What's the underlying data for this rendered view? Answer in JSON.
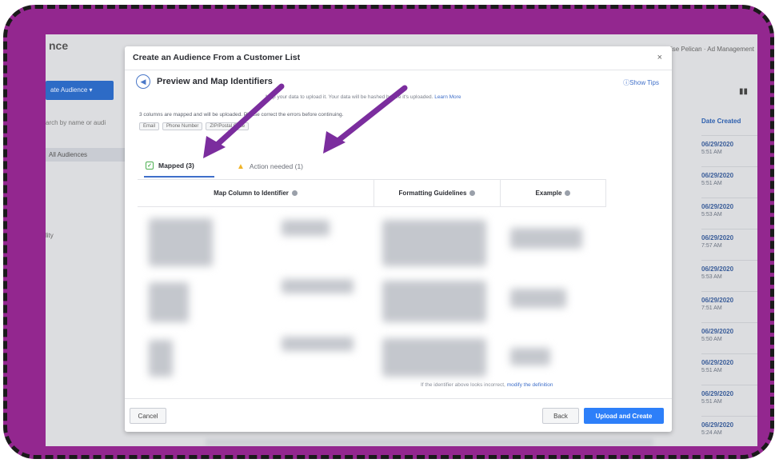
{
  "background": {
    "title": "nce",
    "account": "Wise Pelican · Ad Management",
    "create_button": "ate Audience ▾",
    "search_placeholder": "arch by name or audi",
    "sidebar_items": [
      "All Audiences",
      "lity"
    ],
    "column_header": "Date Created",
    "dates": [
      {
        "date": "06/29/2020",
        "time": "5:51 AM"
      },
      {
        "date": "06/29/2020",
        "time": "5:51 AM"
      },
      {
        "date": "06/29/2020",
        "time": "5:53 AM"
      },
      {
        "date": "06/29/2020",
        "time": "7:57 AM"
      },
      {
        "date": "06/29/2020",
        "time": "5:53 AM"
      },
      {
        "date": "06/29/2020",
        "time": "7:51 AM"
      },
      {
        "date": "06/29/2020",
        "time": "5:50 AM"
      },
      {
        "date": "06/29/2020",
        "time": "5:51 AM"
      },
      {
        "date": "06/29/2020",
        "time": "5:51 AM"
      },
      {
        "date": "06/29/2020",
        "time": "5:24 AM"
      }
    ]
  },
  "modal": {
    "title": "Create an Audience From a Customer List",
    "close": "×",
    "step_title": "Preview and Map Identifiers",
    "show_tips": "ⓘShow Tips",
    "subline": "Map your data to upload it. Your data will be hashed before it's uploaded.",
    "subline_link": "Learn More",
    "summary": "3 columns are mapped and will be uploaded. Please correct the errors before continuing.",
    "chips": [
      "Email",
      "Phone Number",
      "ZIP/Postal Code"
    ],
    "tabs": {
      "mapped": "Mapped (3)",
      "action": "Action needed (1)"
    },
    "table_headers": {
      "map": "Map Column to Identifier",
      "formatting": "Formatting Guidelines",
      "example": "Example"
    },
    "footnote": "If the identifier above looks incorrect,",
    "footnote_link": "modify the definition",
    "buttons": {
      "cancel": "Cancel",
      "back": "Back",
      "upload": "Upload and Create"
    }
  },
  "colors": {
    "frame": "#93278f",
    "arrow": "#7b2d9e",
    "accent": "#2d7ff9"
  }
}
